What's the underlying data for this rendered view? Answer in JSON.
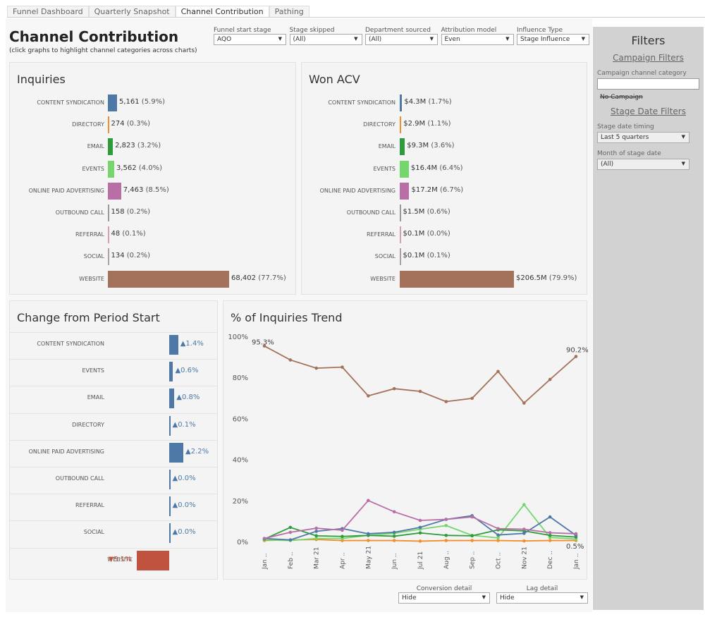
{
  "tabs": [
    "Funnel Dashboard",
    "Quarterly Snapshot",
    "Channel Contribution",
    "Pathing"
  ],
  "active_tab": "Channel Contribution",
  "header": {
    "title": "Channel Contribution",
    "subtitle": "(click graphs to highlight channel categories across charts)"
  },
  "filters": [
    {
      "label": "Funnel start stage",
      "value": "AQO"
    },
    {
      "label": "Stage skipped",
      "value": "(All)"
    },
    {
      "label": "Department sourced",
      "value": "(All)"
    },
    {
      "label": "Attribution model",
      "value": "Even"
    },
    {
      "label": "Influence Type",
      "value": "Stage Influence"
    }
  ],
  "sidebar": {
    "title": "Filters",
    "campaign_filters": "Campaign Filters",
    "campaign_channel_label": "Campaign channel category",
    "campaign_channel_value": "",
    "no_campaign": "No Campaign",
    "stage_date_filters": "Stage Date Filters",
    "stage_timing_label": "Stage date timing",
    "stage_timing_value": "Last 5 quarters",
    "month_label": "Month of stage date",
    "month_value": "(All)"
  },
  "bottom_filters": [
    {
      "label": "Conversion detail",
      "value": "Hide"
    },
    {
      "label": "Lag detail",
      "value": "Hide"
    }
  ],
  "colors": {
    "CONTENT SYNDICATION": "#4e79a7",
    "DIRECTORY": "#f28e2b",
    "EMAIL": "#2e9b3c",
    "EVENTS": "#76d66e",
    "ONLINE PAID ADVERTISING": "#b86fa6",
    "OUTBOUND CALL": "#9a9a9a",
    "REFERRAL": "#d4a0b6",
    "SOCIAL": "#b0a0a0",
    "WEBSITE": "#a4725a",
    "up": "#4e79a7",
    "down": "#c0533f"
  },
  "chart_data": [
    {
      "type": "bar",
      "title": "Inquiries",
      "categories": [
        "CONTENT SYNDICATION",
        "DIRECTORY",
        "EMAIL",
        "EVENTS",
        "ONLINE PAID ADVERTISING",
        "OUTBOUND CALL",
        "REFERRAL",
        "SOCIAL",
        "WEBSITE"
      ],
      "values": [
        5161,
        274,
        2823,
        3562,
        7463,
        158,
        48,
        134,
        68402
      ],
      "labels": [
        "5,161",
        "274",
        "2,823",
        "3,562",
        "7,463",
        "158",
        "48",
        "134",
        "68,402"
      ],
      "pct": [
        "(5.9%)",
        "(0.3%)",
        "(3.2%)",
        "(4.0%)",
        "(8.5%)",
        "(0.2%)",
        "(0.1%)",
        "(0.2%)",
        "(77.7%)"
      ]
    },
    {
      "type": "bar",
      "title": "Won ACV",
      "categories": [
        "CONTENT SYNDICATION",
        "DIRECTORY",
        "EMAIL",
        "EVENTS",
        "ONLINE PAID ADVERTISING",
        "OUTBOUND CALL",
        "REFERRAL",
        "SOCIAL",
        "WEBSITE"
      ],
      "values": [
        4.3,
        2.9,
        9.3,
        16.4,
        17.2,
        1.5,
        0.1,
        0.1,
        206.5
      ],
      "labels": [
        "$4.3M",
        "$2.9M",
        "$9.3M",
        "$16.4M",
        "$17.2M",
        "$1.5M",
        "$0.1M",
        "$0.1M",
        "$206.5M"
      ],
      "pct": [
        "(1.7%)",
        "(1.1%)",
        "(3.6%)",
        "(6.4%)",
        "(6.7%)",
        "(0.6%)",
        "(0.0%)",
        "(0.1%)",
        "(79.9%)"
      ]
    },
    {
      "type": "bar",
      "title": "Change from Period Start",
      "categories": [
        "CONTENT SYNDICATION",
        "EVENTS",
        "EMAIL",
        "DIRECTORY",
        "ONLINE PAID ADVERTISING",
        "OUTBOUND CALL",
        "REFERRAL",
        "SOCIAL",
        "WEBSITE"
      ],
      "values": [
        1.4,
        0.6,
        0.8,
        0.1,
        2.2,
        0.0,
        0.0,
        0.0,
        -5.1
      ],
      "labels": [
        "▲1.4%",
        "▲0.6%",
        "▲0.8%",
        "▲0.1%",
        "▲2.2%",
        "▲0.0%",
        "▲0.0%",
        "▲0.0%",
        "▼5.1%"
      ]
    },
    {
      "type": "line",
      "title": "% of Inquiries Trend",
      "x": [
        "Jan ..",
        "Feb ..",
        "Mar 21",
        "Apr ..",
        "May 21",
        "Jun ..",
        "Jul 21",
        "Aug ..",
        "Sep ..",
        "Oct ..",
        "Nov 21",
        "Dec ..",
        "Jan .."
      ],
      "yticks": [
        "0%",
        "20%",
        "40%",
        "60%",
        "80%",
        "100%"
      ],
      "ylim": [
        0,
        100
      ],
      "series": [
        {
          "name": "WEBSITE",
          "values": [
            95.3,
            88.5,
            84.5,
            85,
            71,
            74.5,
            73.2,
            68.2,
            69.8,
            82.9,
            67.5,
            79,
            90.2
          ]
        },
        {
          "name": "ONLINE PAID ADVERTISING",
          "values": [
            1.5,
            4.5,
            6.5,
            5.5,
            20,
            14.5,
            10.3,
            10.8,
            12,
            6.3,
            6,
            4.3,
            3.8
          ]
        },
        {
          "name": "CONTENT SYNDICATION",
          "values": [
            1.5,
            0.8,
            5,
            6.3,
            3.8,
            4.5,
            6.9,
            10.8,
            12.6,
            3.2,
            4,
            12,
            3
          ]
        },
        {
          "name": "EMAIL",
          "values": [
            1.2,
            6.9,
            2.8,
            2.5,
            3,
            2.6,
            4.2,
            3,
            2.8,
            5.7,
            5.2,
            3,
            2.2
          ]
        },
        {
          "name": "EVENTS",
          "values": [
            0.8,
            0.5,
            1.5,
            1.5,
            3,
            4,
            6,
            7.8,
            3,
            1.8,
            18,
            2,
            1.2
          ]
        },
        {
          "name": "DIRECTORY",
          "values": [
            0.5,
            0.8,
            1,
            0.5,
            0.5,
            0.5,
            0.2,
            0.5,
            0.5,
            0.5,
            0.3,
            0.5,
            0.5
          ]
        }
      ],
      "annotations": [
        "95.3%",
        "90.2%",
        "0.5%"
      ]
    }
  ]
}
